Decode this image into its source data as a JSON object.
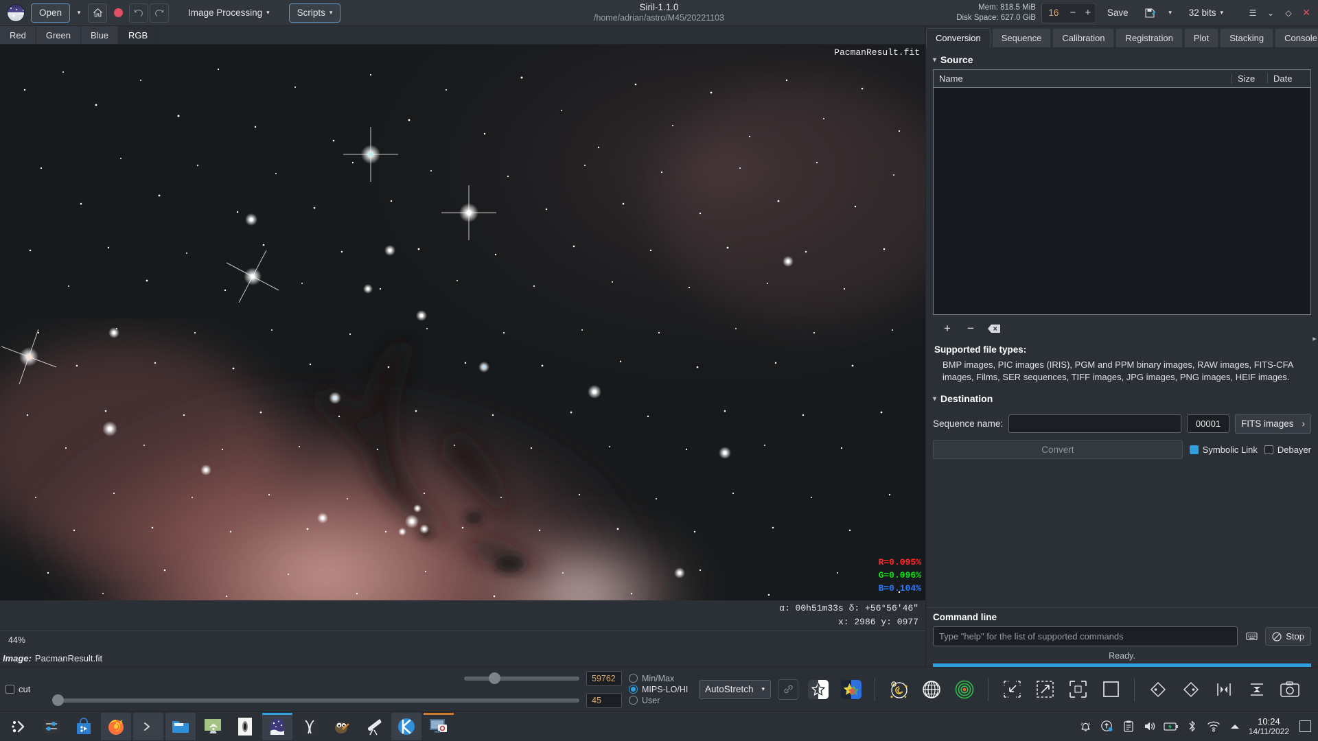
{
  "header": {
    "app_title": "Siril-1.1.0",
    "working_dir": "/home/adrian/astro/M45/20221103",
    "open_label": "Open",
    "image_processing_label": "Image Processing",
    "scripts_label": "Scripts",
    "save_label": "Save",
    "bitdepth_label": "32 bits",
    "memory": "Mem: 818.5 MiB",
    "disk": "Disk Space: 627.0 GiB",
    "zoom_value": "16",
    "minus": "−",
    "plus": "+",
    "dropdown_caret": "▾",
    "menu_glyph": "☰",
    "chevron_glyph": "⌄",
    "maximize_glyph": "◇",
    "close_glyph": "✕"
  },
  "channel_tabs": [
    {
      "label": "Red",
      "active": false
    },
    {
      "label": "Green",
      "active": false
    },
    {
      "label": "Blue",
      "active": false
    },
    {
      "label": "RGB",
      "active": true
    }
  ],
  "viewer": {
    "filename_overlay": "PacmanResult.fit",
    "rgb_readout": {
      "r": "R=0.095%",
      "g": "G=0.096%",
      "b": "B=0.104%"
    },
    "coords_celestial": "α: 00h51m33s δ: +56°56'46\"",
    "coords_pixel": "x: 2986 y: 0977",
    "zoom_percent": "44%",
    "image_label": "Image:",
    "image_name": "PacmanResult.fit"
  },
  "right_panel": {
    "tabs": [
      {
        "label": "Conversion",
        "active": true
      },
      {
        "label": "Sequence",
        "active": false
      },
      {
        "label": "Calibration",
        "active": false
      },
      {
        "label": "Registration",
        "active": false
      },
      {
        "label": "Plot",
        "active": false
      },
      {
        "label": "Stacking",
        "active": false
      },
      {
        "label": "Console",
        "active": false
      }
    ],
    "source": {
      "title": "Source",
      "columns": [
        "Name",
        "Size",
        "Date"
      ],
      "rows": [],
      "add_glyph": "+",
      "remove_glyph": "−",
      "clear_glyph": "⌫"
    },
    "supported": {
      "title": "Supported file types:",
      "text": "BMP images, PIC images (IRIS), PGM and PPM binary images, RAW images, FITS-CFA images, Films, SER sequences, TIFF images, JPG images, PNG images, HEIF images."
    },
    "destination": {
      "title": "Destination",
      "sequence_name_label": "Sequence name:",
      "sequence_name_value": "",
      "sequence_name_placeholder": "",
      "index_value": "00001",
      "format_value": "FITS images",
      "format_caret": "›",
      "convert_label": "Convert",
      "symbolic_link_label": "Symbolic Link",
      "symbolic_link_checked": true,
      "debayer_label": "Debayer",
      "debayer_checked": false
    },
    "command_line": {
      "title": "Command line",
      "input_value": "",
      "input_placeholder": "Type \"help\" for the list of supported commands",
      "stop_label": "Stop",
      "status": "Ready."
    }
  },
  "bottom_tools": {
    "cut_label": "cut",
    "cut_checked": false,
    "hi_value": "59762",
    "lo_value": "45",
    "modes": [
      {
        "label": "Min/Max",
        "selected": false
      },
      {
        "label": "MIPS-LO/HI",
        "selected": true
      },
      {
        "label": "User",
        "selected": false
      }
    ],
    "stretch_mode": "AutoStretch",
    "icons": [
      "chain-link-icon",
      "star-bw-icon",
      "star-color-icon",
      "galaxy-photometry-icon",
      "grid-globe-icon",
      "target-rings-icon",
      "zoom-out-fit-icon",
      "zoom-in-icon",
      "fit-to-window-icon",
      "zoom-one-to-one-icon",
      "crop-icon",
      "rotate-icon",
      "mirror-horizontal-icon",
      "mirror-vertical-icon",
      "snapshot-icon"
    ]
  },
  "taskbar": {
    "apps": [
      "menu-icon",
      "settings-sliders-icon",
      "software-store-icon",
      "firefox-icon",
      "terminal-icon",
      "files-icon",
      "network-share-icon",
      "galaxy-app-icon",
      "siril-icon",
      "pixinsight-icon",
      "gimp-icon",
      "telescope-icon",
      "kstars-icon",
      "screenshot-icon"
    ],
    "tray": [
      "bell-icon",
      "update-icon",
      "clipboard-icon",
      "volume-icon",
      "battery-icon",
      "bluetooth-icon",
      "wifi-icon",
      "expand-tray-icon"
    ],
    "time": "10:24",
    "date": "14/11/2022"
  }
}
